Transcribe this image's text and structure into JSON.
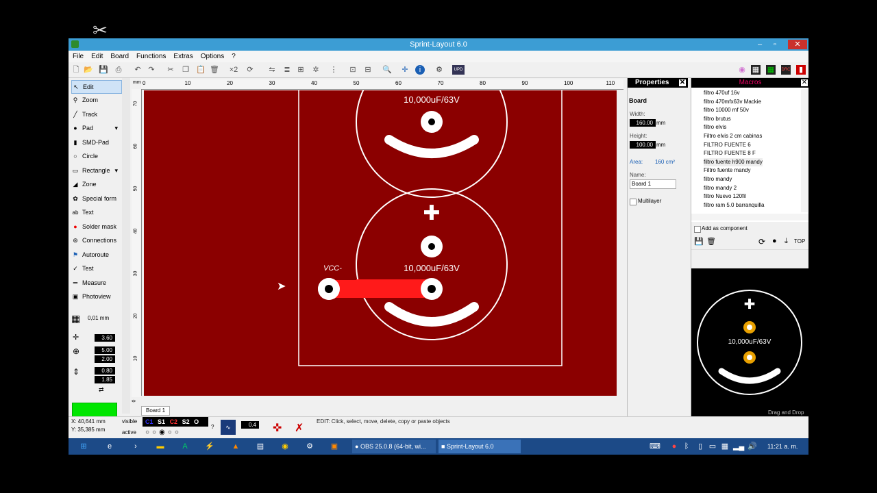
{
  "overlay": {
    "logo_icon": "capcut-logo-icon"
  },
  "window": {
    "title": "Sprint-Layout 6.0",
    "min": "–",
    "max": "▫",
    "close": "✕"
  },
  "menu": [
    "File",
    "Edit",
    "Board",
    "Functions",
    "Extras",
    "Options",
    "?"
  ],
  "tools": [
    {
      "label": "Edit",
      "icon": "cursor-icon",
      "glyph": "↖"
    },
    {
      "label": "Zoom",
      "icon": "magnifier-icon",
      "glyph": "⚲"
    },
    {
      "label": "Track",
      "icon": "track-icon",
      "glyph": "╱"
    },
    {
      "label": "Pad",
      "icon": "pad-icon",
      "glyph": "●"
    },
    {
      "label": "SMD-Pad",
      "icon": "smd-pad-icon",
      "glyph": "▮"
    },
    {
      "label": "Circle",
      "icon": "circle-icon",
      "glyph": "○"
    },
    {
      "label": "Rectangle",
      "icon": "rectangle-icon",
      "glyph": "▭"
    },
    {
      "label": "Zone",
      "icon": "zone-icon",
      "glyph": "◢"
    },
    {
      "label": "Special form",
      "icon": "special-form-icon",
      "glyph": "✿"
    },
    {
      "label": "Text",
      "icon": "text-icon",
      "glyph": "ab"
    },
    {
      "label": "Solder mask",
      "icon": "solder-mask-icon",
      "glyph": "●"
    },
    {
      "label": "Connections",
      "icon": "connections-icon",
      "glyph": "⊛"
    },
    {
      "label": "Autoroute",
      "icon": "autoroute-icon",
      "glyph": "⚑"
    },
    {
      "label": "Test",
      "icon": "test-icon",
      "glyph": "✓"
    },
    {
      "label": "Measure",
      "icon": "measure-icon",
      "glyph": "═"
    },
    {
      "label": "Photoview",
      "icon": "photoview-icon",
      "glyph": "▣"
    }
  ],
  "grid": {
    "value": "0,01 mm"
  },
  "track_width": "3.60",
  "pad_outer": "5.00",
  "pad_inner": "2.00",
  "smd_w": "0.80",
  "smd_h": "1.85",
  "ruler": {
    "unit": "mm",
    "h_ticks": [
      "0",
      "10",
      "20",
      "30",
      "40",
      "50",
      "60",
      "70",
      "80",
      "90",
      "100",
      "110"
    ],
    "v_ticks": [
      "70",
      "60",
      "50",
      "40",
      "30",
      "20",
      "10",
      "0"
    ]
  },
  "board_items": {
    "cap_label_top": "10,000uF/63V",
    "cap_label_bottom": "10,000uF/63V",
    "vcc_label": "VCC-",
    "plus": "✚"
  },
  "board_tab": "Board 1",
  "properties": {
    "title": "Properties",
    "section": "Board",
    "width_label": "Width:",
    "width_value": "160.00",
    "height_label": "Height:",
    "height_value": "100.00",
    "unit": "mm",
    "area_label": "Area:",
    "area_value": "160 cm²",
    "name_label": "Name:",
    "name_value": "Board 1",
    "multilayer": "Multilayer"
  },
  "macros": {
    "title": "Macros",
    "items": [
      "filtro 470uf 16v",
      "filtro 470mfx63v Mackie",
      "filtro 10000 mf 50v",
      "filtro brutus",
      "filtro elvis",
      "Filtro elvis 2 cm cabinas",
      "FILTRO FUENTE 6",
      "FILTRO FUENTE 8 F",
      "filtro fuente h900 mandy",
      "Filtro fuente mandy",
      "filtro mandy",
      "filtro mandy 2",
      "filtro Nuevo 120fil",
      "filtro ram 5.0 barranquilla"
    ],
    "add_component": "Add as component",
    "top": "TOP",
    "preview_label": "10,000uF/63V",
    "drag_drop": "Drag and Drop"
  },
  "status": {
    "x": "X:  40,641 mm",
    "y": "Y:  35,385 mm",
    "visible": "visible",
    "active": "active",
    "layers": [
      "C1",
      "S1",
      "C2",
      "S2",
      "O"
    ],
    "help": "?",
    "zoom": "0.4",
    "message": "EDIT:  Click, select, move, delete, copy or paste objects"
  },
  "taskbar": {
    "obs": "OBS 25.0.8 (64-bit, wi...",
    "sprint": "Sprint-Layout 6.0",
    "time": "11:21 a. m."
  },
  "colors": {
    "board": "#8b0000",
    "track": "#ff1a1a",
    "green": "#00e600",
    "title": "#3c9dd4"
  }
}
